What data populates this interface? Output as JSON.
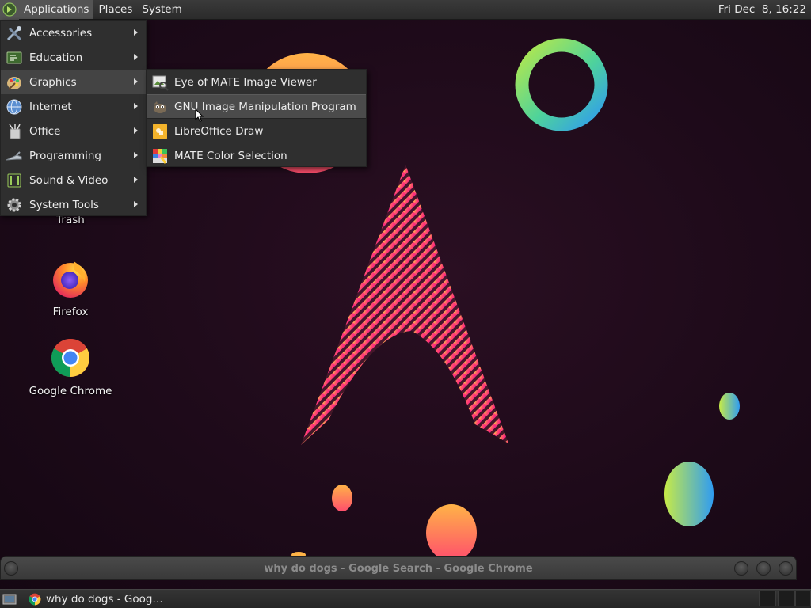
{
  "top_panel": {
    "menus": [
      "Applications",
      "Places",
      "System"
    ],
    "clock": "Fri Dec  8, 16:22"
  },
  "apps_menu": {
    "items": [
      {
        "label": "Accessories",
        "icon": "accessories-icon"
      },
      {
        "label": "Education",
        "icon": "education-icon"
      },
      {
        "label": "Graphics",
        "icon": "graphics-icon"
      },
      {
        "label": "Internet",
        "icon": "internet-icon"
      },
      {
        "label": "Office",
        "icon": "office-icon"
      },
      {
        "label": "Programming",
        "icon": "programming-icon"
      },
      {
        "label": "Sound & Video",
        "icon": "sound-video-icon"
      },
      {
        "label": "System Tools",
        "icon": "system-tools-icon"
      }
    ],
    "highlighted": "Graphics"
  },
  "graphics_submenu": {
    "items": [
      {
        "label": "Eye of MATE Image Viewer",
        "icon": "image-viewer-icon"
      },
      {
        "label": "GNU Image Manipulation Program",
        "icon": "gimp-icon"
      },
      {
        "label": "LibreOffice Draw",
        "icon": "libreoffice-draw-icon"
      },
      {
        "label": "MATE Color Selection",
        "icon": "color-selection-icon"
      }
    ],
    "highlighted": "GNU Image Manipulation Program"
  },
  "desktop_icons": [
    {
      "label": "Trash",
      "icon": "trash-icon"
    },
    {
      "label": "Firefox",
      "icon": "firefox-icon"
    },
    {
      "label": "Google Chrome",
      "icon": "chrome-icon"
    }
  ],
  "window": {
    "title": "why do dogs - Google Search - Google Chrome"
  },
  "taskbar": {
    "task_label": "why do dogs - Goog…"
  }
}
